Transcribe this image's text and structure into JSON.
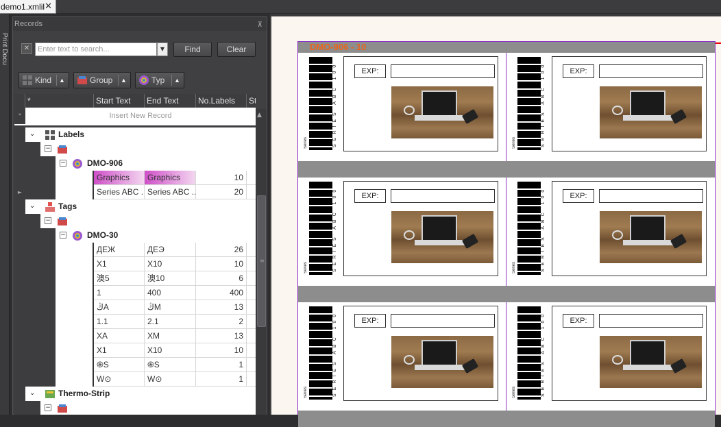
{
  "tab": {
    "title": "demo1.xmlil"
  },
  "side_strip": {
    "label": "Print Docu"
  },
  "panel": {
    "title": "Records",
    "pin_icon": "pin-icon"
  },
  "search": {
    "placeholder": "Enter text to search...",
    "find_label": "Find",
    "clear_label": "Clear"
  },
  "group_buttons": [
    {
      "label": "Kind",
      "icon": "kind-grid-icon"
    },
    {
      "label": "Group",
      "icon": "group-tags-icon"
    },
    {
      "label": "Typ",
      "icon": "type-circle-icon"
    }
  ],
  "columns": [
    "*",
    "Start Text",
    "End Text",
    "No.Labels",
    "Step"
  ],
  "insert_record": {
    "indicator": "*",
    "text": "Insert New Record"
  },
  "groups": [
    {
      "name": "Labels",
      "icon": "labels-grid-icon",
      "subgroup": "DMO-906",
      "rows": [
        {
          "start": "Graphics",
          "end": "Graphics",
          "count": "10",
          "highlight": true
        },
        {
          "start": "Series ABC ...",
          "end": "Series ABC ...",
          "count": "20",
          "highlight": false
        }
      ]
    },
    {
      "name": "Tags",
      "icon": "tags-icon",
      "subgroup": "DMO-30",
      "rows": [
        {
          "start": "ДЕЖ",
          "end": "ДЕЭ",
          "count": "26"
        },
        {
          "start": "X1",
          "end": "X10",
          "count": "10"
        },
        {
          "start": "澳5",
          "end": "澳10",
          "count": "6"
        },
        {
          "start": "1",
          "end": "400",
          "count": "400"
        },
        {
          "start": "ڭA",
          "end": "ڭM",
          "count": "13"
        },
        {
          "start": "1.1",
          "end": "2.1",
          "count": "2"
        },
        {
          "start": "XA",
          "end": "XM",
          "count": "13"
        },
        {
          "start": "X1",
          "end": "X10",
          "count": "10"
        },
        {
          "start": "֍S",
          "end": "֍S",
          "count": "1"
        },
        {
          "start": "W⊙",
          "end": "W⊙",
          "count": "1"
        }
      ]
    },
    {
      "name": "Thermo-Strip",
      "icon": "thermo-strip-icon"
    }
  ],
  "preview": {
    "sheet_title": "DMO-906 - 10",
    "label_exp": "EXP:",
    "label_vertical_text": "SERIES ABC 100",
    "label_side_text": "Series",
    "label_rows": 3,
    "label_cols": 2
  }
}
